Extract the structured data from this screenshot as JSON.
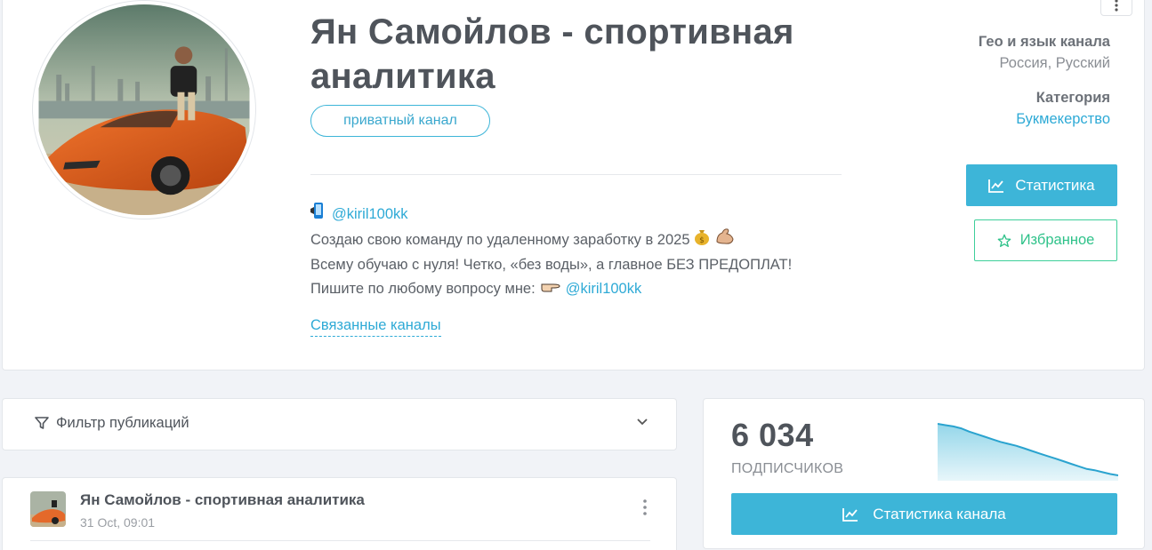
{
  "channel": {
    "title": "Ян Самойлов - спортивная аналитика",
    "private_label": "приватный канал",
    "description": {
      "contact_handle": "@kiril100kk",
      "line2": "Создаю свою команду по удаленному заработку в 2025",
      "line3": "Всему обучаю с нуля! Четко, «без воды», а главное БЕЗ ПРЕДОПЛАТ!",
      "line4_prefix": "Пишите по любому вопросу мне:",
      "line4_handle": "@kiril100kk"
    },
    "related_link": "Связанные каналы"
  },
  "meta": {
    "geo_label": "Гео и язык канала",
    "geo_value": "Россия, Русский",
    "category_label": "Категория",
    "category_value": "Букмекерство"
  },
  "actions": {
    "stats_label": "Статистика",
    "favorite_label": "Избранное"
  },
  "filter": {
    "label": "Фильтр публикаций"
  },
  "post": {
    "channel_name": "Ян Самойлов - спортивная аналитика",
    "date": "31 Oct, 09:01"
  },
  "stats_card": {
    "subscribers": "6 034",
    "subscribers_label": "ПОДПИСЧИКОВ",
    "channel_stats_label": "Статистика канала",
    "sparkline": [
      100,
      98,
      96,
      93,
      88,
      84,
      80,
      76,
      72,
      69,
      66,
      62,
      58,
      54,
      50,
      46,
      42,
      38,
      34,
      30,
      28,
      25,
      22,
      20
    ]
  },
  "colors": {
    "accent": "#3db5d8",
    "favorite": "#3ecf9a",
    "link": "#2eaad6"
  }
}
